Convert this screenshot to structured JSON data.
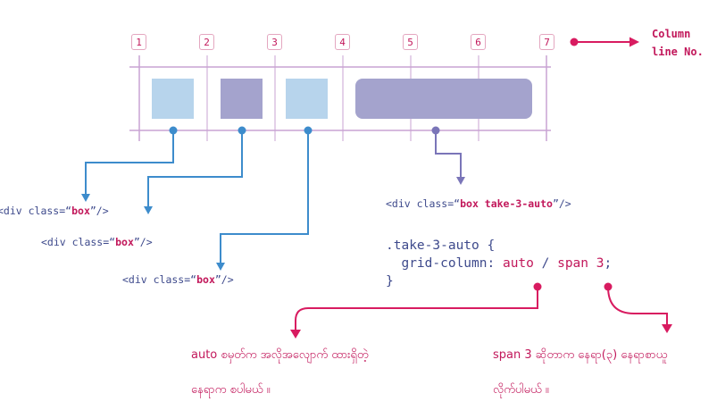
{
  "column_numbers": [
    "1",
    "2",
    "3",
    "4",
    "5",
    "6",
    "7"
  ],
  "column_label": {
    "line1": "Column",
    "line2": "line No."
  },
  "box_labels": [
    {
      "pre": "<div class=“",
      "cls": "box",
      "post": "”/>"
    },
    {
      "pre": "<div class=“",
      "cls": "box",
      "post": "”/>"
    },
    {
      "pre": "<div class=“",
      "cls": "box",
      "post": "”/>"
    }
  ],
  "take3_label": {
    "pre": "<div class=“",
    "cls": "box take-3-auto",
    "post": "”/>"
  },
  "css_rule": {
    "selector": ".take-3-auto {",
    "property": "grid-column:",
    "value_auto": "auto",
    "slash": "/",
    "value_span": "span 3",
    "semicolon": ";",
    "close": "}"
  },
  "notes": {
    "auto_line1": "auto စမှတ်က အလိုအလျောက် ထားရှိတဲ့",
    "auto_line2": "နေရာက စပါမယ် ။",
    "span_line1": "span 3 ဆိုတာက နေရာ(၃) နေရာစာယူ",
    "span_line2": "လိုက်ပါမယ် ။"
  },
  "colors": {
    "grid_line": "#c9a3d3",
    "box_light": "#b7d4ec",
    "box_dark": "#a4a3cd",
    "blue_connector": "#3d8ccc",
    "purple_connector": "#7a75b8",
    "accent_pink": "#d81b60",
    "code_text": "#3e4a8c"
  }
}
